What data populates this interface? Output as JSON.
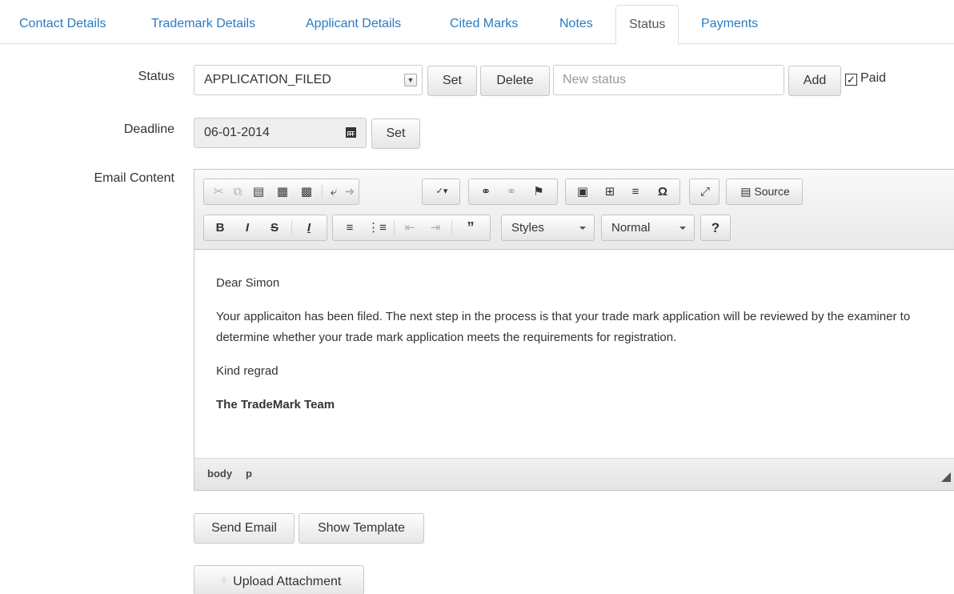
{
  "tabs": [
    {
      "label": "Contact Details"
    },
    {
      "label": "Trademark Details"
    },
    {
      "label": "Applicant Details"
    },
    {
      "label": "Cited Marks"
    },
    {
      "label": "Notes"
    },
    {
      "label": "Status"
    },
    {
      "label": "Payments"
    }
  ],
  "active_tab": "Status",
  "status": {
    "label": "Status",
    "selected": "APPLICATION_FILED",
    "set_label": "Set",
    "delete_label": "Delete",
    "new_status_placeholder": "New status",
    "add_label": "Add",
    "paid_label": "Paid",
    "paid_checked": true
  },
  "deadline": {
    "label": "Deadline",
    "value": "06-01-2014",
    "set_label": "Set"
  },
  "email": {
    "label": "Email Content",
    "toolbar": {
      "source_label": "Source",
      "styles_label": "Styles",
      "format_label": "Normal",
      "help_label": "?"
    },
    "body": {
      "greeting": "Dear Simon",
      "paragraph": "Your applicaiton has been filed. The next step in the process is that your trade mark application will be reviewed by the examiner to determine whether your trade mark application meets the requirements for registration.",
      "closing": "Kind regrad",
      "signature": "The TradeMark Team"
    },
    "path": [
      "body",
      "p"
    ]
  },
  "actions": {
    "send_email_label": "Send Email",
    "show_template_label": "Show Template",
    "upload_label": "Upload Attachment"
  }
}
